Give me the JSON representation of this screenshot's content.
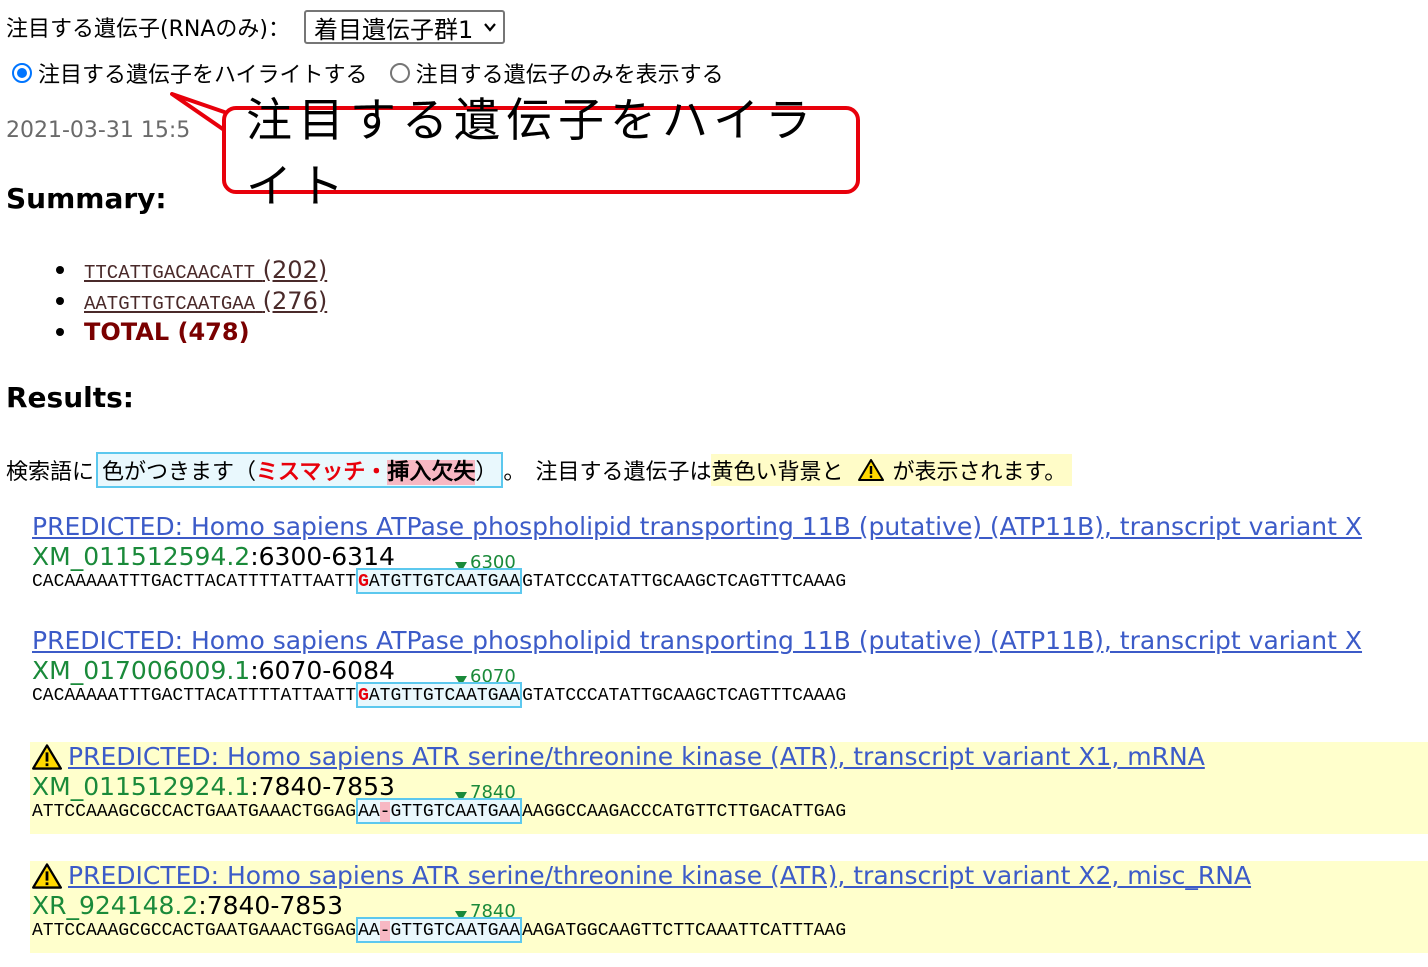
{
  "filter": {
    "label": "注目する遺伝子(RNAのみ)：",
    "selected_value": "着目遺伝子群1",
    "radio_highlight": "注目する遺伝子をハイライトする",
    "radio_only": "注目する遺伝子のみを表示する",
    "radio_selected": "highlight"
  },
  "timestamp": "2021-03-31 15:5",
  "callout": {
    "text": "注目する遺伝子をハイライト",
    "border_color": "#e8000b"
  },
  "summary": {
    "heading": "Summary:",
    "items": [
      {
        "seq": "TTCATTGACAACATT",
        "count": "(202)"
      },
      {
        "seq": "AATGTTGTCAATGAA",
        "count": "(276)"
      }
    ],
    "total": "TOTAL (478)"
  },
  "results": {
    "heading": "Results:",
    "legend": {
      "prefix": "検索語に",
      "box_text": "色がつきます（",
      "mismatch": "ミスマッチ",
      "dot": "・",
      "indel": "挿入欠失",
      "box_close": "）",
      "period": "。",
      "note_pre": "注目する遺伝子は",
      "note_yellow": "黄色い背景と",
      "note_post": "が表示されます。"
    },
    "items": [
      {
        "warn": false,
        "title": "PREDICTED: Homo sapiens ATPase phospholipid transporting 11B (putative) (ATP11B), transcript variant X",
        "accession": "XM_011512594.2",
        "range": ":6300-6314",
        "position": "6300",
        "seq_pre": "CACAAAAATTTGACTTACATTTTATTAATT",
        "seq_match_a": "",
        "seq_mis": "G",
        "seq_gap": "",
        "seq_match_b": "ATGTTGTCAATGAA",
        "seq_post": "GTATCCCATATTGCAAGCTCAGTTTCAAAG"
      },
      {
        "warn": false,
        "title": "PREDICTED: Homo sapiens ATPase phospholipid transporting 11B (putative) (ATP11B), transcript variant X",
        "accession": "XM_017006009.1",
        "range": ":6070-6084",
        "position": "6070",
        "seq_pre": "CACAAAAATTTGACTTACATTTTATTAATT",
        "seq_match_a": "",
        "seq_mis": "G",
        "seq_gap": "",
        "seq_match_b": "ATGTTGTCAATGAA",
        "seq_post": "GTATCCCATATTGCAAGCTCAGTTTCAAAG"
      },
      {
        "warn": true,
        "title": "PREDICTED: Homo sapiens ATR serine/threonine kinase (ATR), transcript variant X1, mRNA",
        "accession": "XM_011512924.1",
        "range": ":7840-7853",
        "position": "7840",
        "seq_pre": "ATTCCAAAGCGCCACTGAATGAAACTGGAG",
        "seq_match_a": "AA",
        "seq_mis": "",
        "seq_gap": "-",
        "seq_match_b": "GTTGTCAATGAA",
        "seq_post": "AAGGCCAAGACCCATGTTCTTGACATTGAG"
      },
      {
        "warn": true,
        "title": "PREDICTED: Homo sapiens ATR serine/threonine kinase (ATR), transcript variant X2, misc_RNA",
        "accession": "XR_924148.2",
        "range": ":7840-7853",
        "position": "7840",
        "seq_pre": "ATTCCAAAGCGCCACTGAATGAAACTGGAG",
        "seq_match_a": "AA",
        "seq_mis": "",
        "seq_gap": "-",
        "seq_match_b": "GTTGTCAATGAA",
        "seq_post": "AAGATGGCAAGTTCTTCAAATTCATTTAAG"
      }
    ]
  },
  "colors": {
    "link": "#3c5bc8",
    "accession": "#1a8a3a",
    "highlight_bg": "#ffffcc",
    "match_border": "#5cc8ee",
    "mismatch": "#e8000b",
    "indel_bg": "#f7b8c3"
  },
  "icons": {
    "warning": "warning-triangle-icon",
    "position_marker": "down-triangle-icon",
    "dropdown": "chevron-down-icon"
  }
}
